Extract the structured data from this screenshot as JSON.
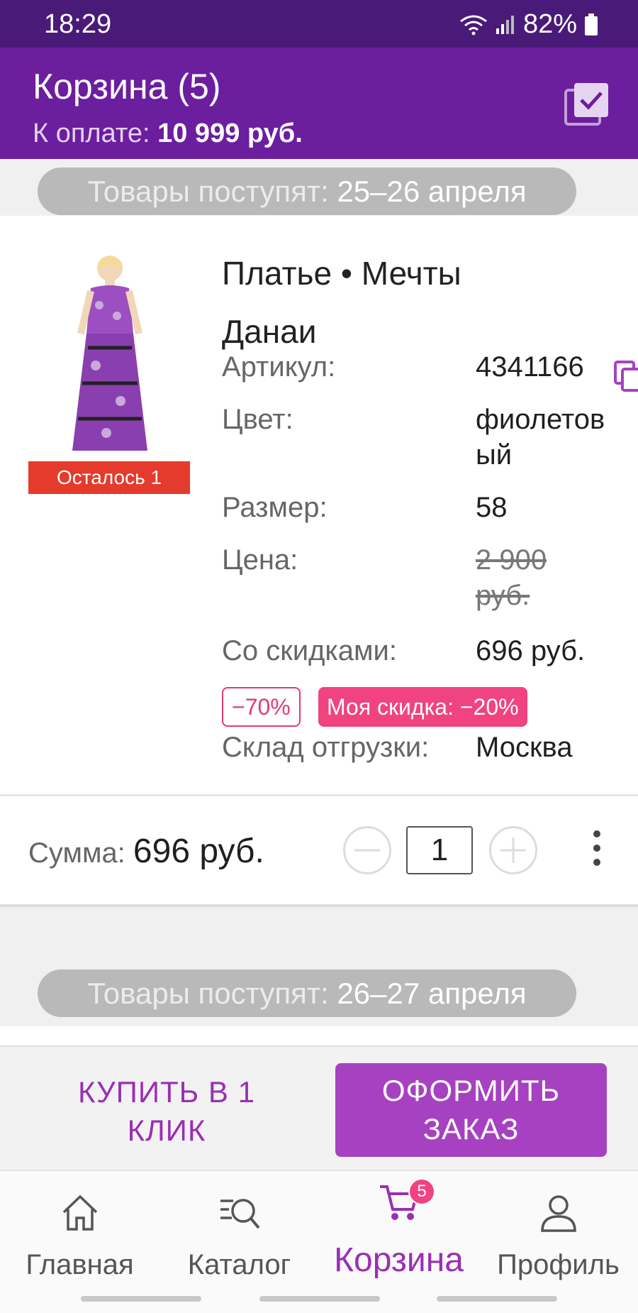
{
  "status_bar": {
    "time": "18:29",
    "battery": "82%"
  },
  "header": {
    "title": "Корзина (5)",
    "pay_label": "К оплате:",
    "pay_value": "10 999 руб."
  },
  "delivery_groups": [
    {
      "label": "Товары поступят:",
      "value": "25–26 апреля"
    },
    {
      "label": "Товары поступят:",
      "value": "26–27 апреля"
    }
  ],
  "item": {
    "name": "Платье • Мечты Данаи",
    "stock_label": "Осталось 1",
    "fields": [
      {
        "key": "Артикул:",
        "value": "4341166"
      },
      {
        "key": "Цвет:",
        "value": "фиолетовый"
      },
      {
        "key": "Размер:",
        "value": "58"
      },
      {
        "key": "Цена:",
        "value": "2 900 руб."
      },
      {
        "key": "Со скидками:",
        "value": "696 руб."
      },
      {
        "key": "Склад отгрузки:",
        "value": "Москва"
      }
    ],
    "discount_badge": "−70%",
    "my_discount_badge": "Моя скидка: −20%",
    "sum_label": "Сумма:",
    "sum_value": "696 руб.",
    "quantity": "1"
  },
  "actions": {
    "buy_one_click": "КУПИТЬ В 1 КЛИК",
    "checkout": "ОФОРМИТЬ ЗАКАЗ"
  },
  "nav": {
    "items": [
      {
        "label": "Главная",
        "icon": "home-icon"
      },
      {
        "label": "Каталог",
        "icon": "catalog-search-icon"
      },
      {
        "label": "Корзина",
        "icon": "cart-icon",
        "badge": "5"
      },
      {
        "label": "Профиль",
        "icon": "profile-icon"
      }
    ]
  },
  "colors": {
    "header": "#6b1e9e",
    "status_bar": "#4a1a78",
    "accent": "#a641c1",
    "discount": "#f0437f",
    "stock": "#e53b2c"
  }
}
